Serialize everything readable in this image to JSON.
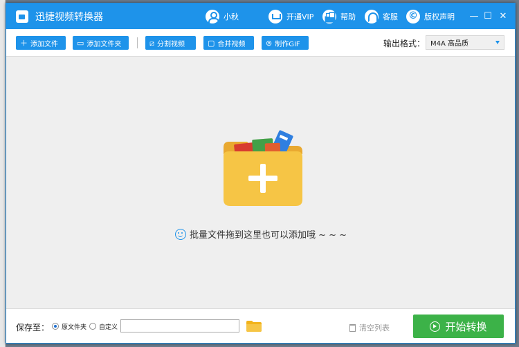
{
  "app": {
    "title": "迅捷视频转换器"
  },
  "titlebar": {
    "user": "小秋",
    "vip": "开通VIP",
    "help": "帮助",
    "service": "客服",
    "copyright": "版权声明",
    "minimize": "—",
    "maximize": "☐",
    "close": "✕"
  },
  "toolbar": {
    "add_file": "添加文件",
    "add_folder": "添加文件夹",
    "split_video": "分割视频",
    "merge_video": "合并视频",
    "make_gif": "制作GIF",
    "format_label": "输出格式：",
    "format_value": "M4A  高品质"
  },
  "main": {
    "drop_hint": "批量文件拖到这里也可以添加哦 ~ ~ ~"
  },
  "footer": {
    "save_to": "保存至：",
    "option_source": "原文件夹",
    "option_custom": "自定义",
    "path_value": "",
    "clear_list": "清空列表",
    "start": "开始转换"
  },
  "colors": {
    "accent": "#1e93ea",
    "start_button": "#3cb248",
    "folder": "#f6c545"
  },
  "icons": [
    "app-logo-icon",
    "user-icon",
    "vip-cart-icon",
    "help-grid-icon",
    "service-headset-icon",
    "copyright-icon",
    "plus-icon",
    "folder-icon",
    "split-icon",
    "merge-icon",
    "gif-icon",
    "smile-icon",
    "trash-icon",
    "play-icon"
  ]
}
